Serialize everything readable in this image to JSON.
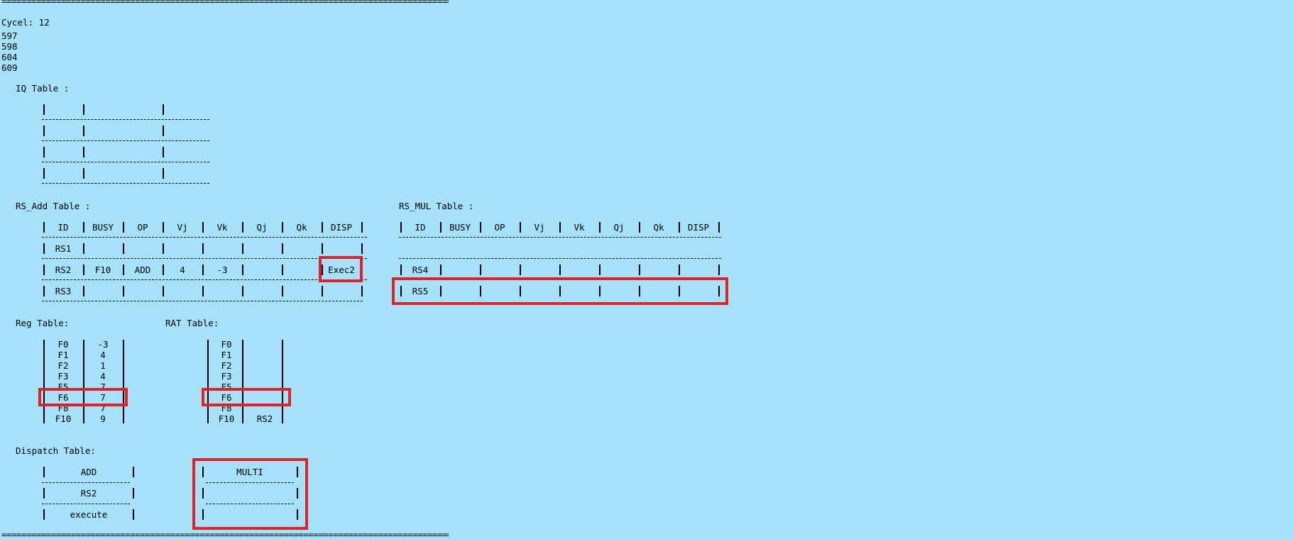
{
  "rule_text": "============================================================================================================",
  "cycle_label": "Cycel: 12",
  "counters": [
    "597",
    "598",
    "604",
    "609"
  ],
  "iq_title": "IQ Table :",
  "rs_add": {
    "title": "RS_Add Table :",
    "headers": [
      "ID",
      "BUSY",
      "OP",
      "Vj",
      "Vk",
      "Qj",
      "Qk",
      "DISP"
    ],
    "rows": [
      [
        "RS1",
        "",
        "",
        "",
        "",
        "",
        "",
        ""
      ],
      [
        "RS2",
        "F10",
        "ADD",
        "4",
        "-3",
        "",
        "",
        "Exec2"
      ],
      [
        "RS3",
        "",
        "",
        "",
        "",
        "",
        "",
        ""
      ]
    ]
  },
  "rs_mul": {
    "title": "RS_MUL Table :",
    "headers": [
      "ID",
      "BUSY",
      "OP",
      "Vj",
      "Vk",
      "Qj",
      "Qk",
      "DISP"
    ],
    "rows": [
      [
        "RS4",
        "",
        "",
        "",
        "",
        "",
        "",
        ""
      ],
      [
        "RS5",
        "",
        "",
        "",
        "",
        "",
        "",
        ""
      ]
    ]
  },
  "reg": {
    "title": "Reg Table:",
    "rows": [
      [
        "F0",
        "-3"
      ],
      [
        "F1",
        "4"
      ],
      [
        "F2",
        "1"
      ],
      [
        "F3",
        "4"
      ],
      [
        "F5",
        "7"
      ],
      [
        "F6",
        "7"
      ],
      [
        "F8",
        "7"
      ],
      [
        "F10",
        "9"
      ]
    ]
  },
  "rat": {
    "title": "RAT Table:",
    "rows": [
      [
        "F0",
        ""
      ],
      [
        "F1",
        ""
      ],
      [
        "F2",
        ""
      ],
      [
        "F3",
        ""
      ],
      [
        "F5",
        ""
      ],
      [
        "F6",
        ""
      ],
      [
        "F8",
        ""
      ],
      [
        "F10",
        "RS2"
      ]
    ]
  },
  "dispatch": {
    "title": "Dispatch Table:",
    "add_column": [
      "ADD",
      "RS2",
      "execute"
    ],
    "multi_column": [
      "MULTI",
      "",
      ""
    ]
  },
  "highlight_color": "#e2202a",
  "background_color": "#a6e1fa"
}
